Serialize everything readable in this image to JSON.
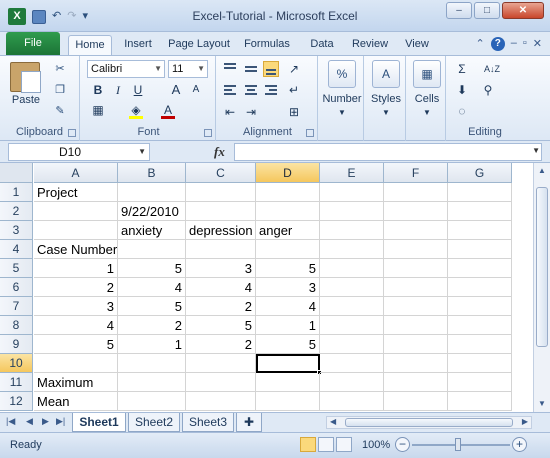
{
  "window": {
    "title": "Excel-Tutorial  -  Microsoft Excel",
    "app_icon": "X",
    "minimize": "–",
    "maximize": "□",
    "close": "✕"
  },
  "quick_access": {
    "undo": "↶",
    "redo": "↷",
    "customize": "▾"
  },
  "ribbon_tabs": {
    "file": "File",
    "tabs": [
      "Home",
      "Insert",
      "Page Layout",
      "Formulas",
      "Data",
      "Review",
      "View"
    ],
    "active": "Home"
  },
  "ribbon": {
    "clipboard": {
      "label": "Clipboard",
      "paste": "Paste"
    },
    "font": {
      "label": "Font",
      "font_name": "Calibri",
      "font_size": "11",
      "bold": "B",
      "italic": "I",
      "underline": "U",
      "grow": "A",
      "shrink": "A",
      "fill_color": "#ffff00",
      "font_color": "#c00000"
    },
    "alignment": {
      "label": "Alignment"
    },
    "number": {
      "label": "Number",
      "icon": "%"
    },
    "styles": {
      "label": "Styles",
      "icon": "A"
    },
    "cells": {
      "label": "Cells",
      "icon": "▦"
    },
    "editing": {
      "label": "Editing",
      "sum": "Σ",
      "sort": "A↓Z",
      "find": "⚲"
    }
  },
  "formula_bar": {
    "name_box": "D10",
    "fx": "fx",
    "formula": ""
  },
  "grid": {
    "columns": [
      "A",
      "B",
      "C",
      "D",
      "E",
      "F",
      "G"
    ],
    "selected_column": "D",
    "selected_row": "10",
    "rows": [
      {
        "num": "1",
        "cells": [
          "Project",
          "",
          "",
          "",
          "",
          "",
          ""
        ]
      },
      {
        "num": "2",
        "cells": [
          "",
          "9/22/2010",
          "",
          "",
          "",
          "",
          ""
        ]
      },
      {
        "num": "3",
        "cells": [
          "",
          "anxiety",
          "depression",
          "anger",
          "",
          "",
          ""
        ]
      },
      {
        "num": "4",
        "cells": [
          "Case Number",
          "",
          "",
          "",
          "",
          "",
          ""
        ]
      },
      {
        "num": "5",
        "cells": [
          "1",
          "5",
          "3",
          "5",
          "",
          "",
          ""
        ]
      },
      {
        "num": "6",
        "cells": [
          "2",
          "4",
          "4",
          "3",
          "",
          "",
          ""
        ]
      },
      {
        "num": "7",
        "cells": [
          "3",
          "5",
          "2",
          "4",
          "",
          "",
          ""
        ]
      },
      {
        "num": "8",
        "cells": [
          "4",
          "2",
          "5",
          "1",
          "",
          "",
          ""
        ]
      },
      {
        "num": "9",
        "cells": [
          "5",
          "1",
          "2",
          "5",
          "",
          "",
          ""
        ]
      },
      {
        "num": "10",
        "cells": [
          "",
          "",
          "",
          "",
          "",
          "",
          ""
        ]
      },
      {
        "num": "11",
        "cells": [
          "Maximum",
          "",
          "",
          "",
          "",
          "",
          ""
        ]
      },
      {
        "num": "12",
        "cells": [
          "Mean",
          "",
          "",
          "",
          "",
          "",
          ""
        ]
      }
    ]
  },
  "sheet_tabs": {
    "tabs": [
      "Sheet1",
      "Sheet2",
      "Sheet3"
    ],
    "active": "Sheet1"
  },
  "status_bar": {
    "status": "Ready",
    "zoom": "100%"
  }
}
